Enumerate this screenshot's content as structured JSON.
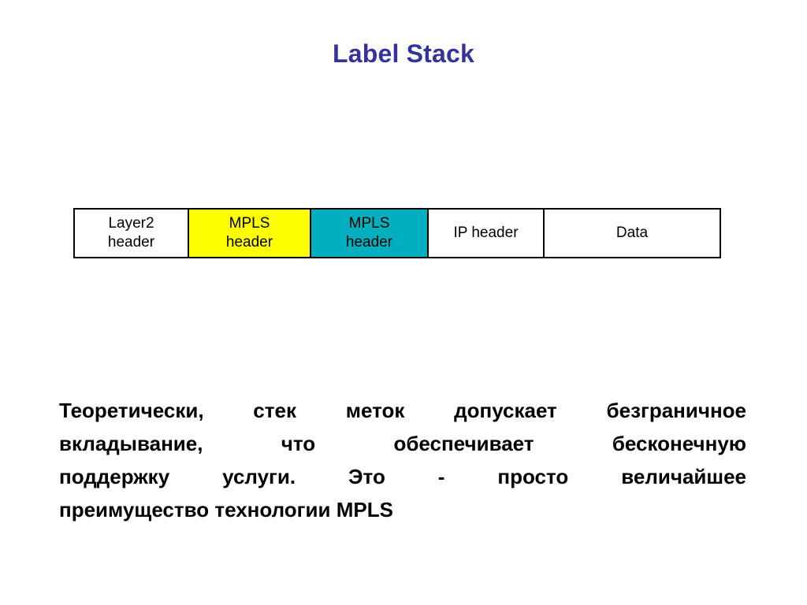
{
  "slide": {
    "title": "Label Stack",
    "background_color": "#ffffff",
    "title_color": "#333399"
  },
  "diagram": {
    "name": "mpls-label-stack-packet-format",
    "fields": [
      {
        "id": "layer2-header",
        "line1": "Layer2",
        "line2": "header",
        "fill": "#ffffff",
        "text_color": "#000000"
      },
      {
        "id": "mpls-header-outer",
        "line1": "MPLS",
        "line2": "header",
        "fill": "#ffff00",
        "text_color": "#000000"
      },
      {
        "id": "mpls-header-inner",
        "line1": "MPLS",
        "line2": "header",
        "fill": "#00afbe",
        "text_color": "#000000"
      },
      {
        "id": "ip-header",
        "line1": "IP header",
        "line2": "",
        "fill": "#ffffff",
        "text_color": "#000000"
      },
      {
        "id": "data",
        "line1": "Data",
        "line2": "",
        "fill": "#ffffff",
        "text_color": "#000000"
      }
    ]
  },
  "body": {
    "lines": [
      "Теоретически, стек меток допускает безграничное",
      "вкладывание, что обеспечивает бесконечную",
      "поддержку услуги. Это - просто величайшее",
      "преимущество технологии MPLS"
    ],
    "full_text": "Теоретически, стек меток допускает безграничное вкладывание, что обеспечивает бесконечную поддержку услуги. Это - просто величайшее преимущество технологии MPLS"
  }
}
